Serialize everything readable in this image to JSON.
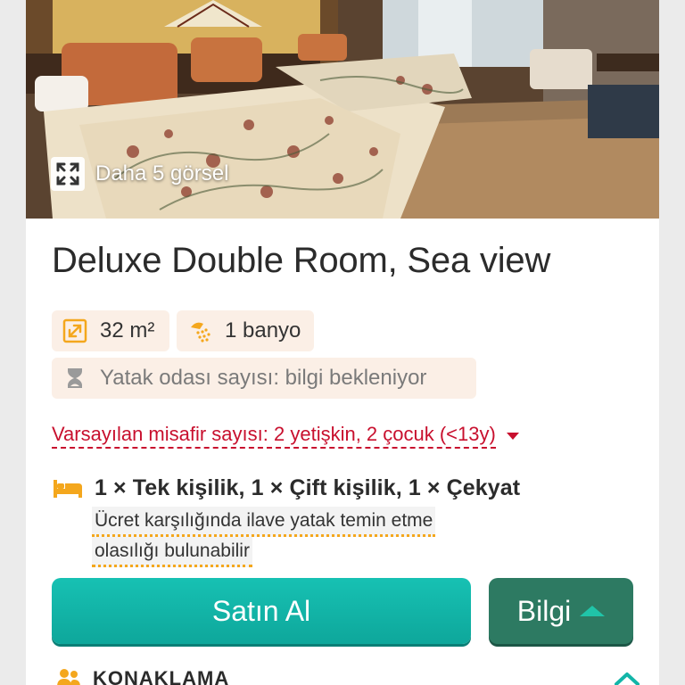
{
  "photo": {
    "caption": "Daha 5 görsel",
    "icon": "expand-icon"
  },
  "room": {
    "title": "Deluxe Double Room, Sea view"
  },
  "chips": {
    "area": {
      "label": "32 m²",
      "icon": "resize-icon"
    },
    "bath": {
      "label": "1 banyo",
      "icon": "shower-icon"
    },
    "bedrooms": {
      "label": "Yatak odası sayısı: bilgi bekleniyor",
      "icon": "hourglass-icon"
    }
  },
  "guests": {
    "label": "Varsayılan misafir sayısı: 2 yetişkin, 2 çocuk (<13y)",
    "color": "#c8102e"
  },
  "beds": {
    "label": "1 × Tek kişilik, 1 × Çift kişilik, 1 × Çekyat",
    "icon": "bed-icon",
    "extra_line1": "Ücret karşılığında ilave yatak temin etme",
    "extra_line2": "olasılığı bulunabilir"
  },
  "actions": {
    "buy_label": "Satın Al",
    "info_label": "Bilgi"
  },
  "section": {
    "label": "KONAKLAMA",
    "icon": "people-icon"
  },
  "colors": {
    "accent": "#12b5a8",
    "info": "#2d7a62",
    "chip_bg": "#fbefe6",
    "icon_orange": "#f4a71d"
  }
}
